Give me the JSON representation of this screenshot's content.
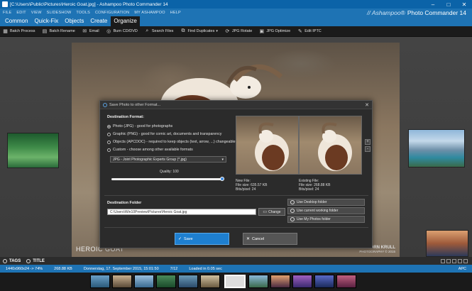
{
  "window": {
    "title": "[C:\\Users\\Public\\Pictures\\Heroic Goat.jpg] - Ashampoo Photo Commander 14",
    "minimize": "–",
    "maximize": "□",
    "close": "✕"
  },
  "menu": [
    "FILE",
    "EDIT",
    "VIEW",
    "SLIDESHOW",
    "TOOLS",
    "CONFIGURATION",
    "MY ASHAMPOO",
    "HELP"
  ],
  "brand": {
    "prefix": "// Ashampoo®",
    "name": "Photo Commander 14"
  },
  "tabs": [
    {
      "label": "Common",
      "active": false
    },
    {
      "label": "Quick-Fix",
      "active": false
    },
    {
      "label": "Objects",
      "active": false
    },
    {
      "label": "Create",
      "active": false
    },
    {
      "label": "Organize",
      "active": true
    }
  ],
  "toolbar": [
    {
      "label": "Batch Process",
      "icon": "batch-process-icon",
      "glyph": "▦"
    },
    {
      "label": "Batch Rename",
      "icon": "batch-rename-icon",
      "glyph": "▤"
    },
    {
      "label": "Email",
      "icon": "email-icon",
      "glyph": "✉"
    },
    {
      "label": "Burn CD/DVD",
      "icon": "disc-icon",
      "glyph": "◎"
    },
    {
      "label": "Search Files",
      "icon": "search-icon",
      "glyph": "⌕"
    },
    {
      "label": "Find Duplicates",
      "icon": "duplicates-icon",
      "glyph": "⧉",
      "caret": "▾"
    },
    {
      "label": "JPG Rotate",
      "icon": "rotate-icon",
      "glyph": "⟳"
    },
    {
      "label": "JPG Optimize",
      "icon": "optimize-icon",
      "glyph": "▣"
    },
    {
      "label": "Edit IPTC",
      "icon": "tag-icon",
      "glyph": "✎"
    }
  ],
  "photo": {
    "caption": "HEROIC GOAT",
    "credit_name": "BJÖRN KRULL",
    "credit_copy": "PHOTOGRAPHY © 2015"
  },
  "dialog": {
    "title": "Save Photo to other Format...",
    "close": "✕",
    "format_label": "Destination Format:",
    "options": [
      {
        "label": "Photo (JPG) - good for photographs",
        "selected": true
      },
      {
        "label": "Graphic (PNG) - good for comic art, documents and transparency",
        "selected": false
      },
      {
        "label": "Objects (APCDOC) - required to keep objects (text, arrow, ...) changeable",
        "selected": false
      },
      {
        "label": "Custom - choose among other available formats",
        "selected": false
      }
    ],
    "format_select": "JPG - Joint Photographic Experts Group (*.jpg)",
    "select_arrow": "▾",
    "quality_label": "Quality: 100",
    "quality_value": 100,
    "new_file": {
      "title": "New File:",
      "size": "File size: 635.57 KB",
      "bits": "Bits/pixel: 24"
    },
    "existing_file": {
      "title": "Existing File:",
      "size": "File size: 268.88 KB",
      "bits": "Bits/pixel: 24"
    },
    "zoom_in": "+",
    "zoom_out": "-",
    "folder_label": "Destination Folder",
    "folder_path": "C:\\Users\\Win10Preview\\Pictures\\Heroic Goat.jpg",
    "change_label": "Change",
    "folder_buttons": [
      "Use Desktop folder",
      "Use current working folder",
      "Use My Photos folder"
    ],
    "save_label": "Save",
    "cancel_label": "Cancel"
  },
  "tagbar": {
    "tags": "TAGS",
    "title": "TITLE"
  },
  "status": {
    "dims": "1440x960x24 -> 74%",
    "size": "268.88 KB",
    "date": "Donnerstag, 17. September 2015, 15:01:50",
    "index": "7/12",
    "loaded": "Loaded in 0.05 sec",
    "mode": "APC"
  }
}
